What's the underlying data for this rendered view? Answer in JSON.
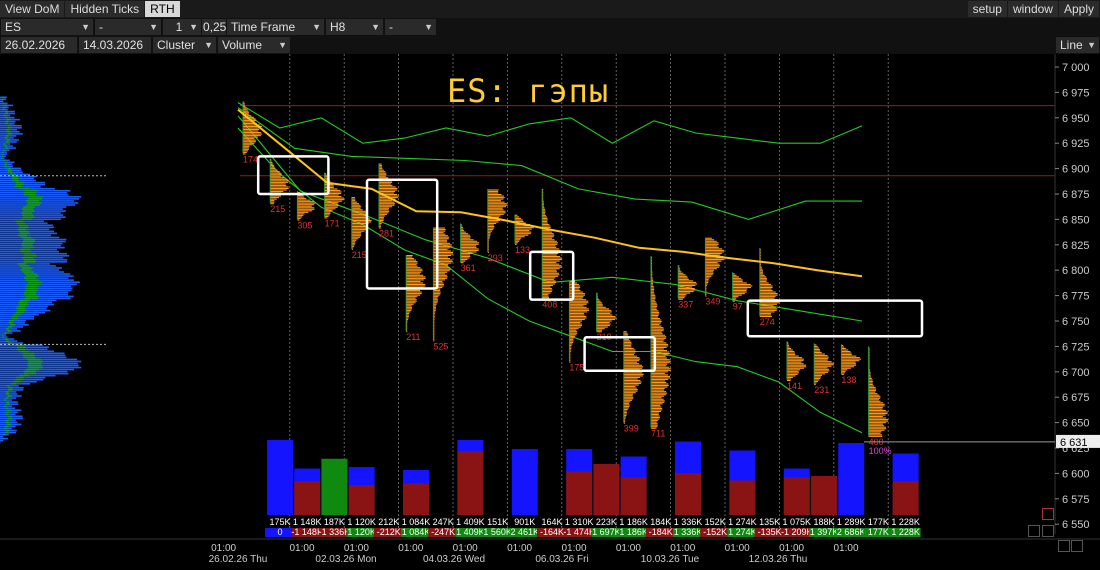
{
  "toolbar": {
    "tabs": [
      "View DoM",
      "Hidden Ticks",
      "RTH"
    ],
    "active_tab": "RTH",
    "right_buttons": [
      "setup",
      "window",
      "Apply"
    ]
  },
  "controls_row1": {
    "symbol": "ES",
    "field2": "-",
    "stepper": "1",
    "step": "0,25",
    "mode": "Time Frame",
    "timeframe": "H8",
    "field7": "-"
  },
  "controls_row2": {
    "date_from": "26.02.2026",
    "date_to": "14.03.2026",
    "chart_type": "Cluster",
    "metric": "Volume",
    "render": "Line"
  },
  "colors": {
    "background": "#000000",
    "profile_orange": "#ff9a1a",
    "poc_line": "#ffc21a",
    "va_lines": "#22cc22",
    "ask_volume": "#1414ff",
    "bid_volume": "#8a1414",
    "delta_positive": "#0f8a0f",
    "title": "#ffcc33",
    "annotation_box": "#ffffff"
  },
  "icons": [
    "chevron-down-icon",
    "resize-icon",
    "grid-icon",
    "scroll-left-icon",
    "scroll-right-icon"
  ],
  "chart_data": {
    "type": "cluster",
    "title": "ES: гэпы",
    "price_axis": {
      "ylim": [
        6625,
        7012
      ],
      "ticks": [
        "7 000",
        "6 975",
        "6 950",
        "6 925",
        "6 900",
        "6 875",
        "6 850",
        "6 825",
        "6 800",
        "6 775",
        "6 750",
        "6 725",
        "6 700",
        "6 675",
        "6 650",
        "6 625",
        "6 600",
        "6 575",
        "6 550"
      ],
      "last_price": "6 631"
    },
    "time_axis": {
      "times": [
        "01:00",
        "01:00",
        "01:00",
        "01:00",
        "01:00",
        "01:00",
        "01:00",
        "01:00",
        "01:00",
        "01:00",
        "01:00",
        "01:00"
      ],
      "dates": [
        "26.02.26 Thu",
        "02.03.26 Mon",
        "04.03.26 Wed",
        "06.03.26 Fri",
        "10.03.26 Tue",
        "12.03.26 Thu"
      ]
    },
    "bars": [
      {
        "high": 6966,
        "low": 6915,
        "poc": 6938,
        "label": "174",
        "vol": "175K",
        "delta": "0",
        "ask": 1.0,
        "bid": 0.0
      },
      {
        "high": 6910,
        "low": 6866,
        "poc": 6885,
        "label": "215",
        "vol": "1 148K",
        "delta": "-1 148K",
        "ask": 0.62,
        "bid": 0.45
      },
      {
        "high": 6878,
        "low": 6850,
        "poc": 6864,
        "label": "305",
        "vol": "187K",
        "delta": "-1 336K",
        "ask": 0.0,
        "bid": 0.75
      },
      {
        "high": 6896,
        "low": 6852,
        "poc": 6872,
        "label": "171",
        "vol": "1 120K",
        "delta": "1 120K",
        "ask": 0.64,
        "bid": 0.4
      },
      {
        "high": 6872,
        "low": 6821,
        "poc": 6849,
        "label": "215",
        "vol": "212K",
        "delta": "-212K",
        "ask": 0.0,
        "bid": 0.0
      },
      {
        "high": 6905,
        "low": 6842,
        "poc": 6875,
        "label": "281",
        "vol": "1 084K",
        "delta": "1 084K",
        "ask": 0.6,
        "bid": 0.42
      },
      {
        "high": 6815,
        "low": 6740,
        "poc": 6790,
        "label": "211",
        "vol": "247K",
        "delta": "-247K",
        "ask": 0.0,
        "bid": 0.0
      },
      {
        "high": 6842,
        "low": 6731,
        "poc": 6815,
        "label": "525",
        "vol": "1 409K",
        "delta": "1 409K",
        "ask": 1.0,
        "bid": 0.85
      },
      {
        "high": 6846,
        "low": 6808,
        "poc": 6824,
        "label": "361",
        "vol": "151K",
        "delta": "1 560K",
        "ask": 0.0,
        "bid": 0.0
      },
      {
        "high": 6880,
        "low": 6818,
        "poc": 6864,
        "label": "293",
        "vol": "901K",
        "delta": "2 461K",
        "ask": 0.88,
        "bid": 0.0
      },
      {
        "high": 6855,
        "low": 6826,
        "poc": 6841,
        "label": "133",
        "vol": "164K",
        "delta": "-164K",
        "ask": 0.0,
        "bid": 0.0
      },
      {
        "high": 6880,
        "low": 6772,
        "poc": 6810,
        "label": "408",
        "vol": "1 310K",
        "delta": "-1 474K",
        "ask": 0.88,
        "bid": 0.58
      },
      {
        "high": 6790,
        "low": 6710,
        "poc": 6764,
        "label": "175",
        "vol": "223K",
        "delta": "1 697K",
        "ask": 0.0,
        "bid": 0.68
      },
      {
        "high": 6778,
        "low": 6740,
        "poc": 6754,
        "label": "219",
        "vol": "1 186K",
        "delta": "1 186K",
        "ask": 0.78,
        "bid": 0.5
      },
      {
        "high": 6740,
        "low": 6650,
        "poc": 6700,
        "label": "399",
        "vol": "184K",
        "delta": "-184K",
        "ask": 0.0,
        "bid": 0.0
      },
      {
        "high": 6814,
        "low": 6645,
        "poc": 6706,
        "label": "711",
        "vol": "1 336K",
        "delta": "1 336K",
        "ask": 0.98,
        "bid": 0.56
      },
      {
        "high": 6805,
        "low": 6772,
        "poc": 6785,
        "label": "337",
        "vol": "152K",
        "delta": "-152K",
        "ask": 0.0,
        "bid": 0.0
      },
      {
        "high": 6832,
        "low": 6775,
        "poc": 6815,
        "label": "349",
        "vol": "1 274K",
        "delta": "1 274K",
        "ask": 0.86,
        "bid": 0.46
      },
      {
        "high": 6798,
        "low": 6770,
        "poc": 6784,
        "label": "97",
        "vol": "135K",
        "delta": "-135K",
        "ask": 0.0,
        "bid": 0.0
      },
      {
        "high": 6822,
        "low": 6755,
        "poc": 6770,
        "label": "274",
        "vol": "1 075K",
        "delta": "-1 209K",
        "ask": 0.62,
        "bid": 0.5
      },
      {
        "high": 6730,
        "low": 6692,
        "poc": 6708,
        "label": "141",
        "vol": "188K",
        "delta": "1 397K",
        "ask": 0.0,
        "bid": 0.52
      },
      {
        "high": 6728,
        "low": 6688,
        "poc": 6708,
        "label": "231",
        "vol": "1 289K",
        "delta": "2 686K",
        "ask": 0.96,
        "bid": 0.0
      },
      {
        "high": 6727,
        "low": 6698,
        "poc": 6712,
        "label": "138",
        "vol": "177K",
        "delta": "177K",
        "ask": 0.0,
        "bid": 0.0
      },
      {
        "high": 6725,
        "low": 6637,
        "poc": 6655,
        "label": "400",
        "vol": "1 228K",
        "delta": "1 228K",
        "ask": 0.82,
        "bid": 0.45
      }
    ],
    "last_bar_extra_label": "100%",
    "poc_line": [
      6958,
      6922,
      6886,
      6880,
      6858,
      6857,
      6849,
      6840,
      6832,
      6822,
      6818,
      6812,
      6807,
      6800,
      6794
    ],
    "va_line_series": [
      {
        "points": [
          6965,
          6940,
          6950,
          6925,
          6930,
          6940,
          6932,
          6944,
          6950,
          6925,
          6947,
          6935,
          6930,
          6925,
          6925,
          6942
        ]
      },
      {
        "points": [
          6960,
          6920,
          6912,
          6910,
          6908,
          6903,
          6880,
          6870,
          6867,
          6850,
          6868,
          6868
        ]
      },
      {
        "points": [
          6952,
          6878,
          6855,
          6830,
          6812,
          6788,
          6793,
          6786,
          6770,
          6760,
          6750
        ]
      },
      {
        "points": [
          6940,
          6895,
          6862,
          6845,
          6820,
          6805,
          6772,
          6750,
          6735,
          6720,
          6720,
          6710,
          6705,
          6690,
          6660,
          6640
        ]
      }
    ],
    "horizontal_levels": [
      6962,
      6893
    ],
    "annotation_boxes": [
      {
        "from_price": 6912,
        "to_price": 6875,
        "bar_from": 1,
        "bar_to": 2
      },
      {
        "from_price": 6889,
        "to_price": 6782,
        "bar_from": 5,
        "bar_to": 6
      },
      {
        "from_price": 6818,
        "to_price": 6771,
        "bar_from": 11,
        "bar_to": 11
      },
      {
        "from_price": 6734,
        "to_price": 6701,
        "bar_from": 13,
        "bar_to": 14
      },
      {
        "from_price": 6770,
        "to_price": 6735,
        "bar_from": 19,
        "bar_to": 22
      }
    ]
  }
}
